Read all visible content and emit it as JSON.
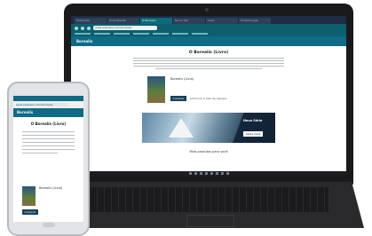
{
  "browser": {
    "tabs": [
      "Startseite",
      "Produktseite",
      "O Borealis",
      "Neuer Tab",
      "Leser",
      "Einstellungen"
    ],
    "active_tab_index": 2,
    "url": "www.example.com/borealis"
  },
  "laptop_page": {
    "app_header": "Borealis",
    "heading": "O Borealis (Livro)",
    "product_title": "Borealis (Livro)",
    "buy_label": "Comprar",
    "product_link": "Adicionar à lista de desejos",
    "banner_title": "Nova Série",
    "banner_button": "Saiba mais",
    "bottom_heading": "Mais produtos para você"
  },
  "phone_page": {
    "url": "www.example.com/borealis",
    "app_header": "Borealis",
    "heading": "O Borealis (Livro)",
    "product_title": "Borealis (Livro)",
    "buy_label": "Comprar"
  }
}
